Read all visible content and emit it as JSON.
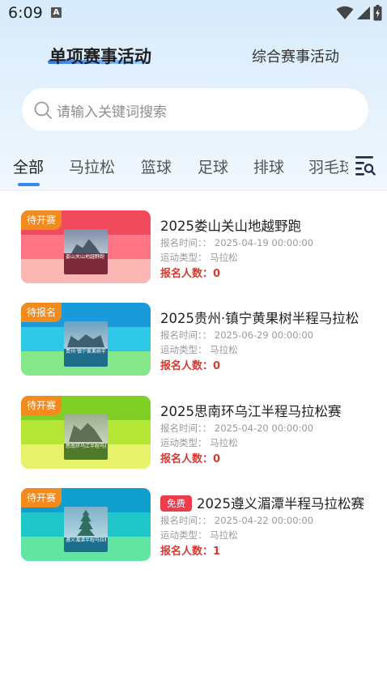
{
  "status_bar": {
    "time": "6:09",
    "indicator": "A",
    "icons": [
      "wifi-icon",
      "signal-icon",
      "battery-icon"
    ]
  },
  "header": {
    "tabs": [
      {
        "label": "单项赛事活动",
        "active": true
      },
      {
        "label": "综合赛事活动",
        "active": false
      }
    ]
  },
  "search": {
    "placeholder": "请输入关键词搜索",
    "icon": "search-icon"
  },
  "categories": [
    "全部",
    "马拉松",
    "篮球",
    "足球",
    "排球",
    "羽毛球"
  ],
  "active_category": "全部",
  "filter_icon": "list-search-icon",
  "labels": {
    "time_label": "报名时间：：",
    "type_label": "运动类型：",
    "count_label": "报名人数：",
    "free_tag": "免费"
  },
  "events": [
    {
      "badge": "待开赛",
      "title": "2025娄山关山地越野跑",
      "date": "2025-04-19 00:00:00",
      "type": "马拉松",
      "count": "0",
      "free": false,
      "poster_text": "娄山关山地越野跑",
      "colors": {
        "top": "#f04a5c",
        "mid": "#ff7586",
        "bot": "#fbb7b4"
      }
    },
    {
      "badge": "待报名",
      "title": "2025贵州·镇宁黄果树半程马拉松",
      "date": "2025-06-29 00:00:00",
      "type": "马拉松",
      "count": "0",
      "free": false,
      "poster_text": "贵州·镇宁黄果树半程马拉松",
      "colors": {
        "top": "#1a9ad8",
        "mid": "#2fc8e6",
        "bot": "#86e78a"
      }
    },
    {
      "badge": "待开赛",
      "title": "2025思南环乌江半程马拉松赛",
      "date": "2025-04-20 00:00:00",
      "type": "马拉松",
      "count": "0",
      "free": false,
      "poster_text": "思南环乌江半程马拉松",
      "colors": {
        "top": "#7fcf25",
        "mid": "#b6e635",
        "bot": "#e6f36a"
      }
    },
    {
      "badge": "待开赛",
      "title": "2025遵义湄潭半程马拉松赛",
      "date": "2025-04-22 00:00:00",
      "type": "马拉松",
      "count": "1",
      "free": true,
      "poster_text": "遵义湄潭半程马拉松",
      "colors": {
        "top": "#0f9fcf",
        "mid": "#1ec6c7",
        "bot": "#61e5a0"
      }
    }
  ]
}
